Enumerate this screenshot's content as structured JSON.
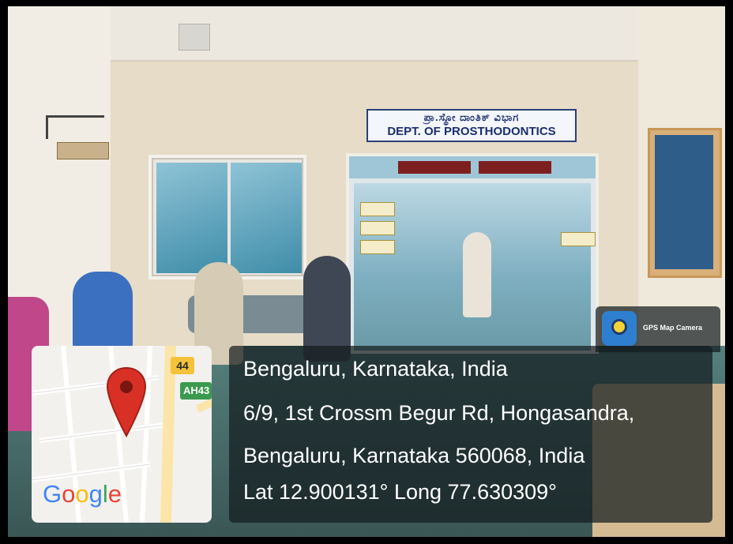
{
  "sign": {
    "kannada": "ಪ್ರಾ.ಸ್ಥೋ ದಾಂತಿಕ್ ವಿಭಾಗ",
    "english": "DEPT. OF PROSTHODONTICS"
  },
  "map": {
    "route_badge_1": "44",
    "route_badge_2": "AH43",
    "provider_logo": "Google",
    "pin_color": "#d93025"
  },
  "location": {
    "line1": "Bengaluru, Karnataka, India",
    "line2": "6/9, 1st Crossm Begur Rd, Hongasandra,",
    "line3": "Bengaluru, Karnataka 560068, India",
    "line4": "Lat 12.900131° Long 77.630309°"
  },
  "app": {
    "name": "GPS Map Camera",
    "icon": "gps-camera-icon"
  },
  "colors": {
    "google_blue": "#4285F4",
    "google_red": "#EA4335",
    "google_yellow": "#FBBC05",
    "google_green": "#34A853"
  }
}
